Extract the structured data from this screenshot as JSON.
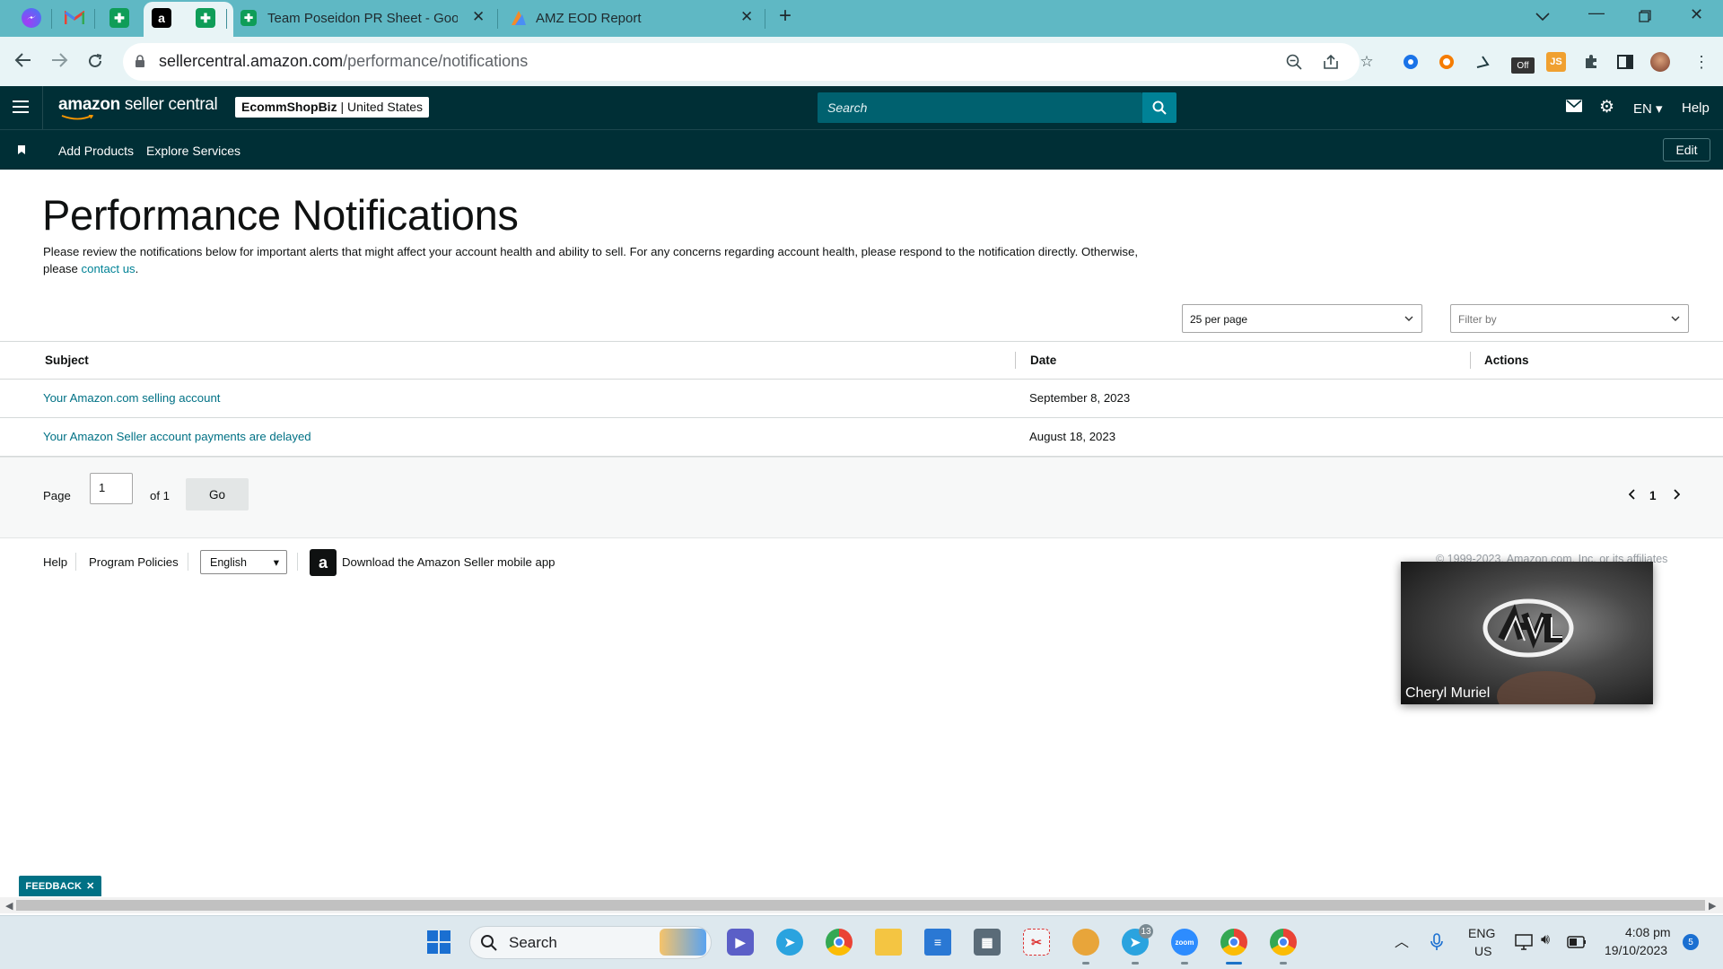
{
  "browser": {
    "tabs": [
      {
        "icon": "messenger-icon",
        "title": ""
      },
      {
        "icon": "gmail-icon",
        "title": ""
      },
      {
        "icon": "sheets-icon",
        "title": ""
      },
      {
        "icon": "amazon-icon",
        "title": "",
        "active": true
      },
      {
        "icon": "sheets-icon",
        "title": ""
      },
      {
        "icon": "sheets-icon",
        "title": "Team Poseidon PR Sheet - Goog"
      },
      {
        "icon": "eod-icon",
        "title": "AMZ EOD Report"
      }
    ],
    "url_host": "sellercentral.amazon.com",
    "url_path": "/performance/notifications"
  },
  "header": {
    "brand_bold": "amazon",
    "brand_rest": " seller central",
    "store_name": "EcommShopBiz",
    "store_region": " | United States",
    "search_placeholder": "Search",
    "language": "EN",
    "help": "Help"
  },
  "subnav": {
    "links": [
      "Add Products",
      "Explore Services"
    ],
    "edit": "Edit"
  },
  "page": {
    "title": "Performance Notifications",
    "intro": "Please review the notifications below for important alerts that might affect your account health and ability to sell. For any concerns regarding account health, please respond to the notification directly. Otherwise, please ",
    "intro_link": "contact us",
    "intro_end": "."
  },
  "filters": {
    "per_page": "25 per page",
    "filter_placeholder": "Filter by"
  },
  "table": {
    "columns": [
      "Subject",
      "Date",
      "Actions"
    ],
    "rows": [
      {
        "subject": "Your Amazon.com selling account",
        "date": "September 8, 2023"
      },
      {
        "subject": "Your Amazon Seller account payments are delayed",
        "date": "August 18, 2023"
      }
    ]
  },
  "pager": {
    "page_label": "Page",
    "page_value": "1",
    "of_label": "of 1",
    "go": "Go",
    "current": "1"
  },
  "footer": {
    "help": "Help",
    "policies": "Program Policies",
    "language": "English",
    "app_text": "Download the Amazon Seller mobile app",
    "copyright": "© 1999-2023, Amazon.com, Inc. or its affiliates"
  },
  "video": {
    "participant": "Cheryl Muriel"
  },
  "feedback": "FEEDBACK",
  "taskbar": {
    "search": "Search",
    "lang_top": "ENG",
    "lang_bottom": "US",
    "time": "4:08 pm",
    "date": "19/10/2023",
    "notifications": "5",
    "telegram_badge": "13"
  },
  "colors": {
    "header_bg": "#002f36",
    "link": "#007185",
    "search_btn": "#008296",
    "tabstrip": "#5fb8c4"
  }
}
